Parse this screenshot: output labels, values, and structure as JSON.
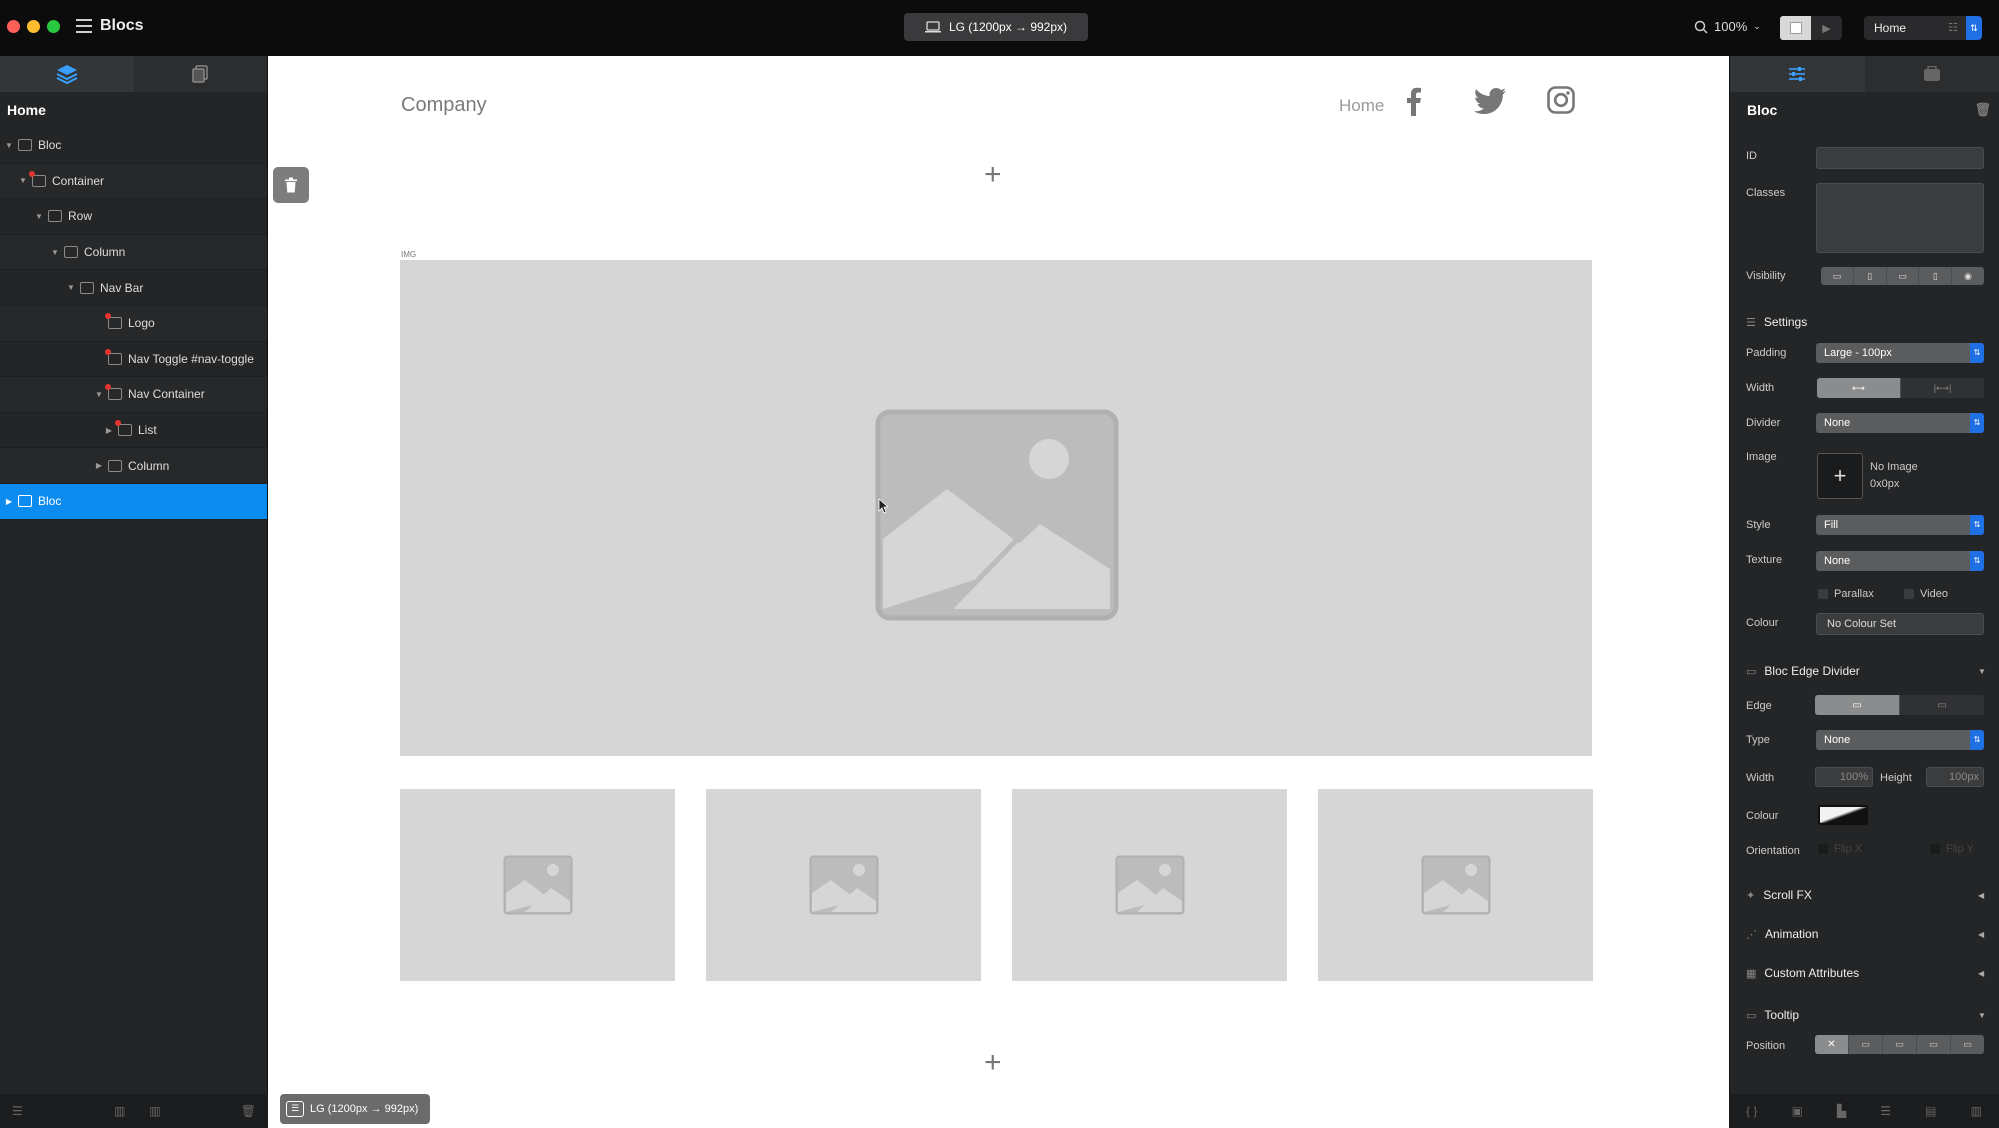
{
  "window": {
    "app_name": "Blocs",
    "device_label": "LG (1200px → 992px)",
    "zoom": "100%",
    "current_page": "Home"
  },
  "colors": {
    "selection": "#0d8cf0",
    "accent_blue": "#1f6fe5",
    "panel_bg": "#232527",
    "placeholder_gray": "#d6d6d6"
  },
  "left_panel": {
    "title": "Home",
    "tree": [
      {
        "label": "Bloc",
        "depth": 0
      },
      {
        "label": "Container",
        "depth": 1
      },
      {
        "label": "Row",
        "depth": 2
      },
      {
        "label": "Column",
        "depth": 3
      },
      {
        "label": "Nav Bar",
        "depth": 4
      },
      {
        "label": "Logo",
        "depth": 5
      },
      {
        "label": "Nav Toggle #nav-toggle",
        "depth": 5
      },
      {
        "label": "Nav Container",
        "depth": 5
      },
      {
        "label": "List",
        "depth": 6
      },
      {
        "label": "Column",
        "depth": 5
      },
      {
        "label": "Bloc",
        "depth": 0,
        "selected": true
      }
    ]
  },
  "canvas": {
    "brand": "Company",
    "nav_link": "Home",
    "img_tag": "IMG",
    "breakpoint_badge": "LG (1200px → 992px)"
  },
  "inspector": {
    "title": "Bloc",
    "id_label": "ID",
    "classes_label": "Classes",
    "visibility_label": "Visibility",
    "settings_title": "Settings",
    "padding_label": "Padding",
    "padding_value": "Large - 100px",
    "width_label": "Width",
    "divider_label": "Divider",
    "divider_value": "None",
    "image_label": "Image",
    "image_name": "No Image",
    "image_size": "0x0px",
    "style_label": "Style",
    "style_value": "Fill",
    "texture_label": "Texture",
    "texture_value": "None",
    "parallax_label": "Parallax",
    "video_label": "Video",
    "colour_label": "Colour",
    "colour_value": "No Colour Set",
    "edge_divider_title": "Bloc Edge Divider",
    "edge_label": "Edge",
    "type_label": "Type",
    "type_value": "None",
    "ed_width_label": "Width",
    "ed_width_value": "100%",
    "ed_height_label": "Height",
    "ed_height_value": "100px",
    "ed_colour_label": "Colour",
    "orientation_label": "Orientation",
    "flip_x": "Flip X",
    "flip_y": "Flip Y",
    "scroll_fx": "Scroll FX",
    "animation": "Animation",
    "custom_attributes": "Custom Attributes",
    "tooltip": "Tooltip",
    "position_label": "Position"
  }
}
